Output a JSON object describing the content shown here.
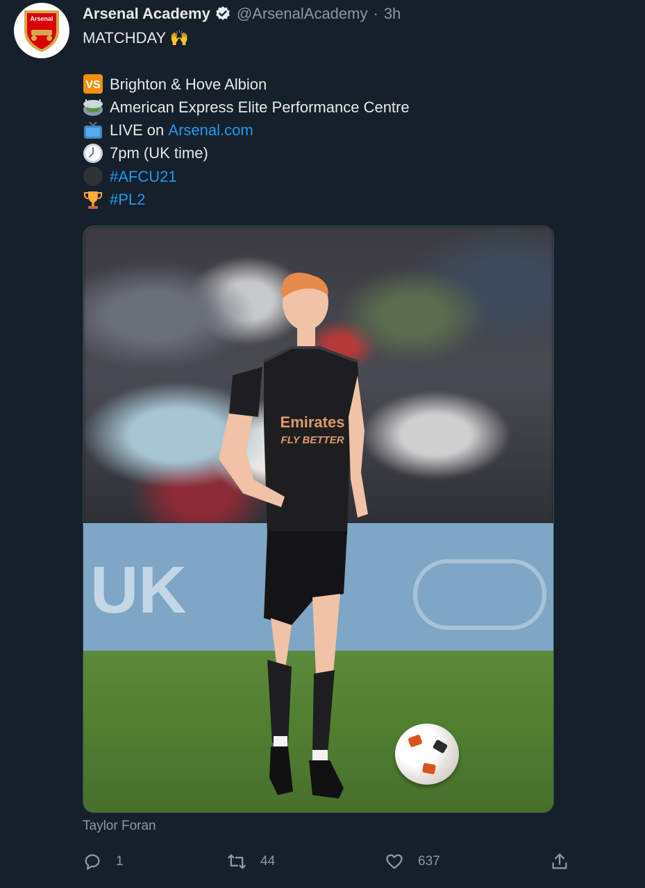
{
  "tweet": {
    "author_name": "Arsenal Academy",
    "handle": "@ArsenalAcademy",
    "separator": "·",
    "time": "3h",
    "avatar_text": "Arsenal",
    "lines": [
      {
        "emoji": "",
        "text": "MATCHDAY 🙌"
      },
      {
        "emoji": "",
        "text": ""
      },
      {
        "emoji": "vs-icon",
        "text": "Brighton & Hove Albion"
      },
      {
        "emoji": "stadium-icon",
        "text": "American Express Elite Performance Centre"
      },
      {
        "emoji": "tv-icon",
        "prefix": "LIVE on ",
        "link": "Arsenal.com"
      },
      {
        "emoji": "clock-icon",
        "text": "7pm (UK time)"
      },
      {
        "emoji": "dark-circle-icon",
        "link": "#AFCU21"
      },
      {
        "emoji": "trophy-icon",
        "link": "#PL2"
      }
    ],
    "media": {
      "shirt_sponsor": "Emirates",
      "shirt_slogan": "FLY BETTER",
      "board_text": "UK"
    },
    "photo_credit": "Taylor Foran",
    "actions": {
      "reply_count": "1",
      "retweet_count": "44",
      "like_count": "637"
    }
  },
  "colors": {
    "background": "#15202b",
    "link": "#1d9bf0",
    "secondary_text": "#8b98a5"
  }
}
